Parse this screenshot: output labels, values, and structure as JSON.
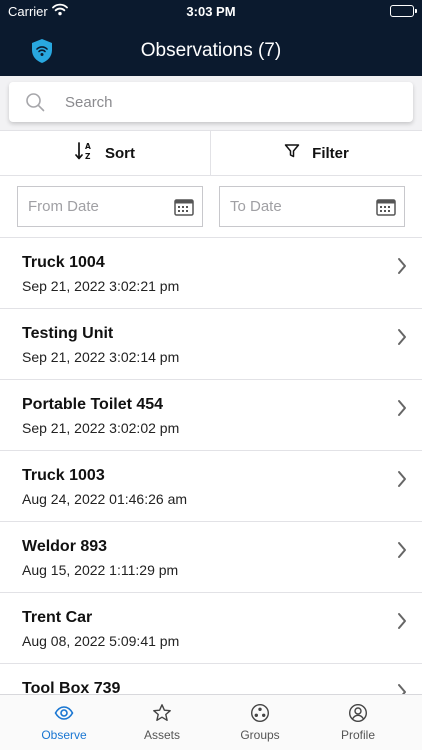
{
  "status_bar": {
    "carrier": "Carrier",
    "time": "3:03 PM",
    "battery_level": 1.0
  },
  "nav": {
    "title": "Observations (7)",
    "logo_icon": "shield-wifi-icon"
  },
  "search": {
    "placeholder": "Search"
  },
  "toolbar": {
    "sort_label": "Sort",
    "filter_label": "Filter"
  },
  "dates": {
    "from_placeholder": "From Date",
    "to_placeholder": "To Date"
  },
  "observations": [
    {
      "name": "Truck 1004",
      "timestamp": "Sep 21, 2022 3:02:21 pm"
    },
    {
      "name": "Testing Unit",
      "timestamp": "Sep 21, 2022 3:02:14 pm"
    },
    {
      "name": "Portable Toilet 454",
      "timestamp": "Sep 21, 2022 3:02:02 pm"
    },
    {
      "name": "Truck 1003",
      "timestamp": "Aug 24, 2022 01:46:26 am"
    },
    {
      "name": "Weldor 893",
      "timestamp": "Aug 15, 2022 1:11:29 pm"
    },
    {
      "name": "Trent Car",
      "timestamp": "Aug 08, 2022 5:09:41 pm"
    },
    {
      "name": "Tool Box 739",
      "timestamp": ""
    }
  ],
  "tabs": [
    {
      "label": "Observe",
      "icon": "eye-icon",
      "active": true
    },
    {
      "label": "Assets",
      "icon": "star-icon",
      "active": false
    },
    {
      "label": "Groups",
      "icon": "groups-icon",
      "active": false
    },
    {
      "label": "Profile",
      "icon": "profile-icon",
      "active": false
    }
  ],
  "colors": {
    "header_bg": "#0b1a2e",
    "accent": "#1976d2",
    "logo": "#29a8e0"
  }
}
